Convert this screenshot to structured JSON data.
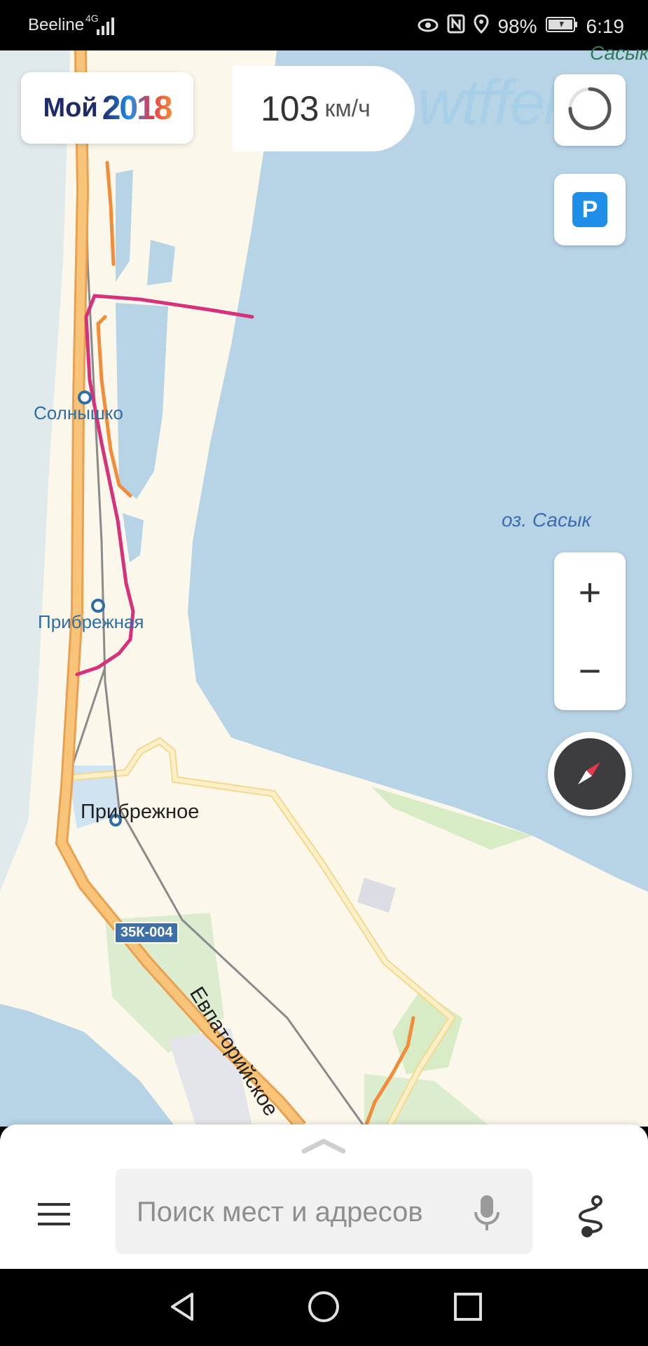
{
  "status_bar": {
    "carrier": "Beeline",
    "network": "4G",
    "battery": "98%",
    "time": "6:19"
  },
  "map": {
    "logo": {
      "moi": "Мой",
      "year": "2018"
    },
    "speed": {
      "value": "103",
      "unit": "км/ч"
    },
    "watermark": "wtffelt",
    "corner_label": "Сасык",
    "places": {
      "solnyshko": "Солнышко",
      "pribrezhnaya": "Прибрежная",
      "pribrezhnoe": "Прибрежное",
      "lake": "оз. Сасык"
    },
    "road_badge": "35К-004",
    "street": "Евпаторийское",
    "parking_label": "P",
    "zoom_in": "+",
    "zoom_out": "−",
    "colors": {
      "water": "#b7d3e6",
      "land": "#fbf7ea",
      "highway": "#f6b867",
      "route_pink": "#d6317a",
      "route_orange": "#f08c3a",
      "accent": "#1f8ee8"
    }
  },
  "search": {
    "placeholder": "Поиск мест и адресов"
  },
  "icons": {
    "menu": "hamburger-icon",
    "mic": "microphone-icon",
    "route": "route-icon",
    "parking": "parking-icon",
    "loader": "loading-arc-icon",
    "compass": "compass-icon",
    "nav_back": "back-triangle-icon",
    "nav_home": "home-circle-icon",
    "nav_recent": "recent-square-icon"
  }
}
